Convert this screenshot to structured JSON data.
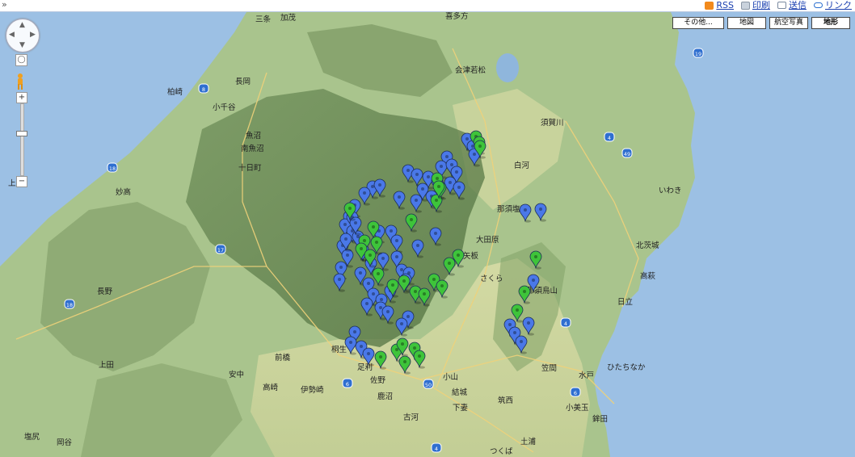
{
  "toolbar": {
    "links": [
      {
        "label": "RSS",
        "icon": "rss-icon"
      },
      {
        "label": "印刷",
        "icon": "print-icon"
      },
      {
        "label": "送信",
        "icon": "mail-icon"
      },
      {
        "label": "リンク",
        "icon": "link-icon"
      }
    ]
  },
  "controls": {
    "map_types": [
      "その他...",
      "地図",
      "航空写真",
      "地形"
    ],
    "active_map_type": "地形"
  },
  "colors": {
    "pin_blue": "#4a78e8",
    "pin_green": "#3ec43a",
    "sea": "#9cc0e4",
    "land": "#a9c48d"
  },
  "map": {
    "place_labels": [
      "三条",
      "加茂",
      "喜多方",
      "会津若松",
      "柏崎",
      "長岡",
      "小千谷",
      "魚沼",
      "南魚沼",
      "須賀川",
      "白河",
      "那須塩原",
      "十日町",
      "妙高",
      "いわき",
      "上越",
      "大田原",
      "北茨城",
      "矢板",
      "さくら",
      "高萩",
      "那須烏山",
      "長野",
      "日立",
      "ひたちなか",
      "水戸",
      "笠間",
      "前橋",
      "桐生",
      "足利",
      "小山",
      "佐野",
      "上田",
      "安中",
      "高崎",
      "伊勢崎",
      "結城",
      "鹿沼",
      "下妻",
      "古河",
      "筑西",
      "土浦",
      "つくば",
      "小美玉",
      "鉾田",
      "塩尻",
      "岡谷"
    ],
    "road_shields": [
      "8",
      "18",
      "17",
      "18",
      "19",
      "4",
      "49",
      "6",
      "4",
      "50",
      "4",
      "6"
    ]
  }
}
